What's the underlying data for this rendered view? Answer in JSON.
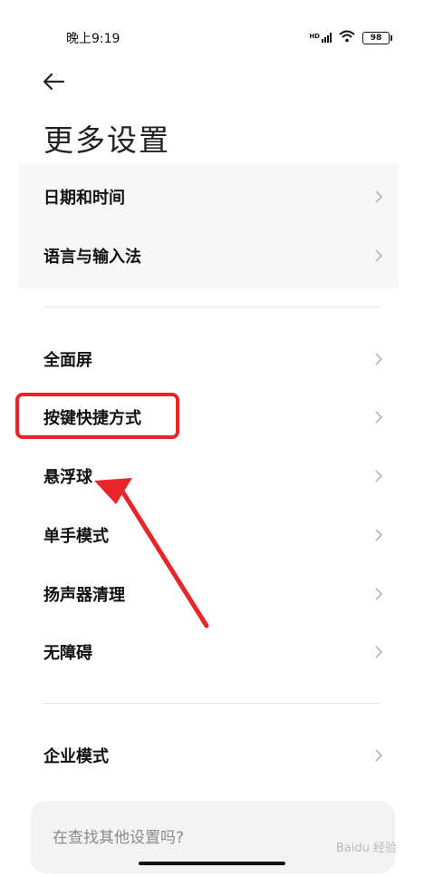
{
  "status": {
    "time": "晚上9:19",
    "signal": "HD",
    "battery": "98"
  },
  "header": {
    "title": "更多设置"
  },
  "group1": {
    "items": [
      {
        "label": "日期和时间"
      },
      {
        "label": "语言与输入法"
      }
    ]
  },
  "group2": {
    "items": [
      {
        "label": "全面屏"
      },
      {
        "label": "按键快捷方式"
      },
      {
        "label": "悬浮球"
      },
      {
        "label": "单手模式"
      },
      {
        "label": "扬声器清理"
      },
      {
        "label": "无障碍"
      }
    ]
  },
  "group3": {
    "items": [
      {
        "label": "企业模式"
      }
    ]
  },
  "search_card": {
    "text": "在查找其他设置吗?"
  },
  "watermark": {
    "text": "Baidu 经验"
  },
  "annotation": {
    "highlight_color": "#e8262a"
  }
}
